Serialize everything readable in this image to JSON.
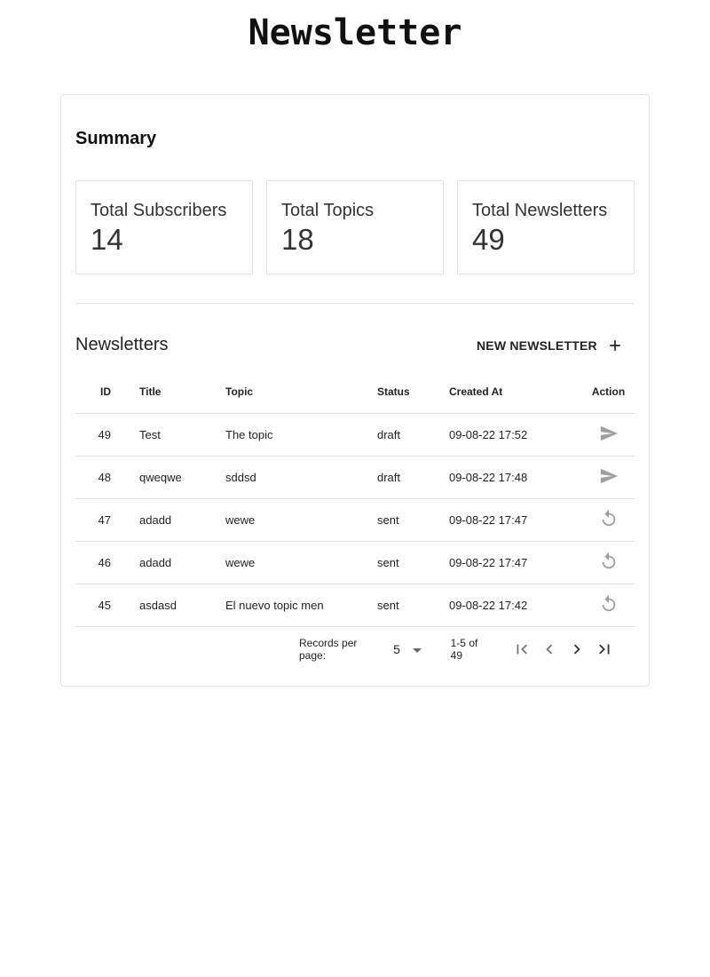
{
  "app": {
    "title": "Newsletter"
  },
  "summary": {
    "heading": "Summary",
    "stats": [
      {
        "label": "Total Subscribers",
        "value": "14"
      },
      {
        "label": "Total Topics",
        "value": "18"
      },
      {
        "label": "Total Newsletters",
        "value": "49"
      }
    ]
  },
  "newsletters": {
    "title": "Newsletters",
    "new_button_label": "NEW NEWSLETTER",
    "columns": {
      "id": "ID",
      "title": "Title",
      "topic": "Topic",
      "status": "Status",
      "created_at": "Created At",
      "action": "Action"
    },
    "rows": [
      {
        "id": "49",
        "title": "Test",
        "topic": "The topic",
        "status": "draft",
        "created_at": "09-08-22 17:52",
        "action_icon": "send-icon"
      },
      {
        "id": "48",
        "title": "qweqwe",
        "topic": "sddsd",
        "status": "draft",
        "created_at": "09-08-22 17:48",
        "action_icon": "send-icon"
      },
      {
        "id": "47",
        "title": "adadd",
        "topic": "wewe",
        "status": "sent",
        "created_at": "09-08-22 17:47",
        "action_icon": "resend-icon"
      },
      {
        "id": "46",
        "title": "adadd",
        "topic": "wewe",
        "status": "sent",
        "created_at": "09-08-22 17:47",
        "action_icon": "resend-icon"
      },
      {
        "id": "45",
        "title": "asdasd",
        "topic": "El nuevo topic men",
        "status": "sent",
        "created_at": "09-08-22 17:42",
        "action_icon": "resend-icon"
      }
    ],
    "status_colors": {
      "draft": "#f0a030",
      "sent": "#4caf50"
    }
  },
  "pagination": {
    "records_per_page_label": "Records per page:",
    "records_per_page": "5",
    "range": "1-5 of 49"
  }
}
